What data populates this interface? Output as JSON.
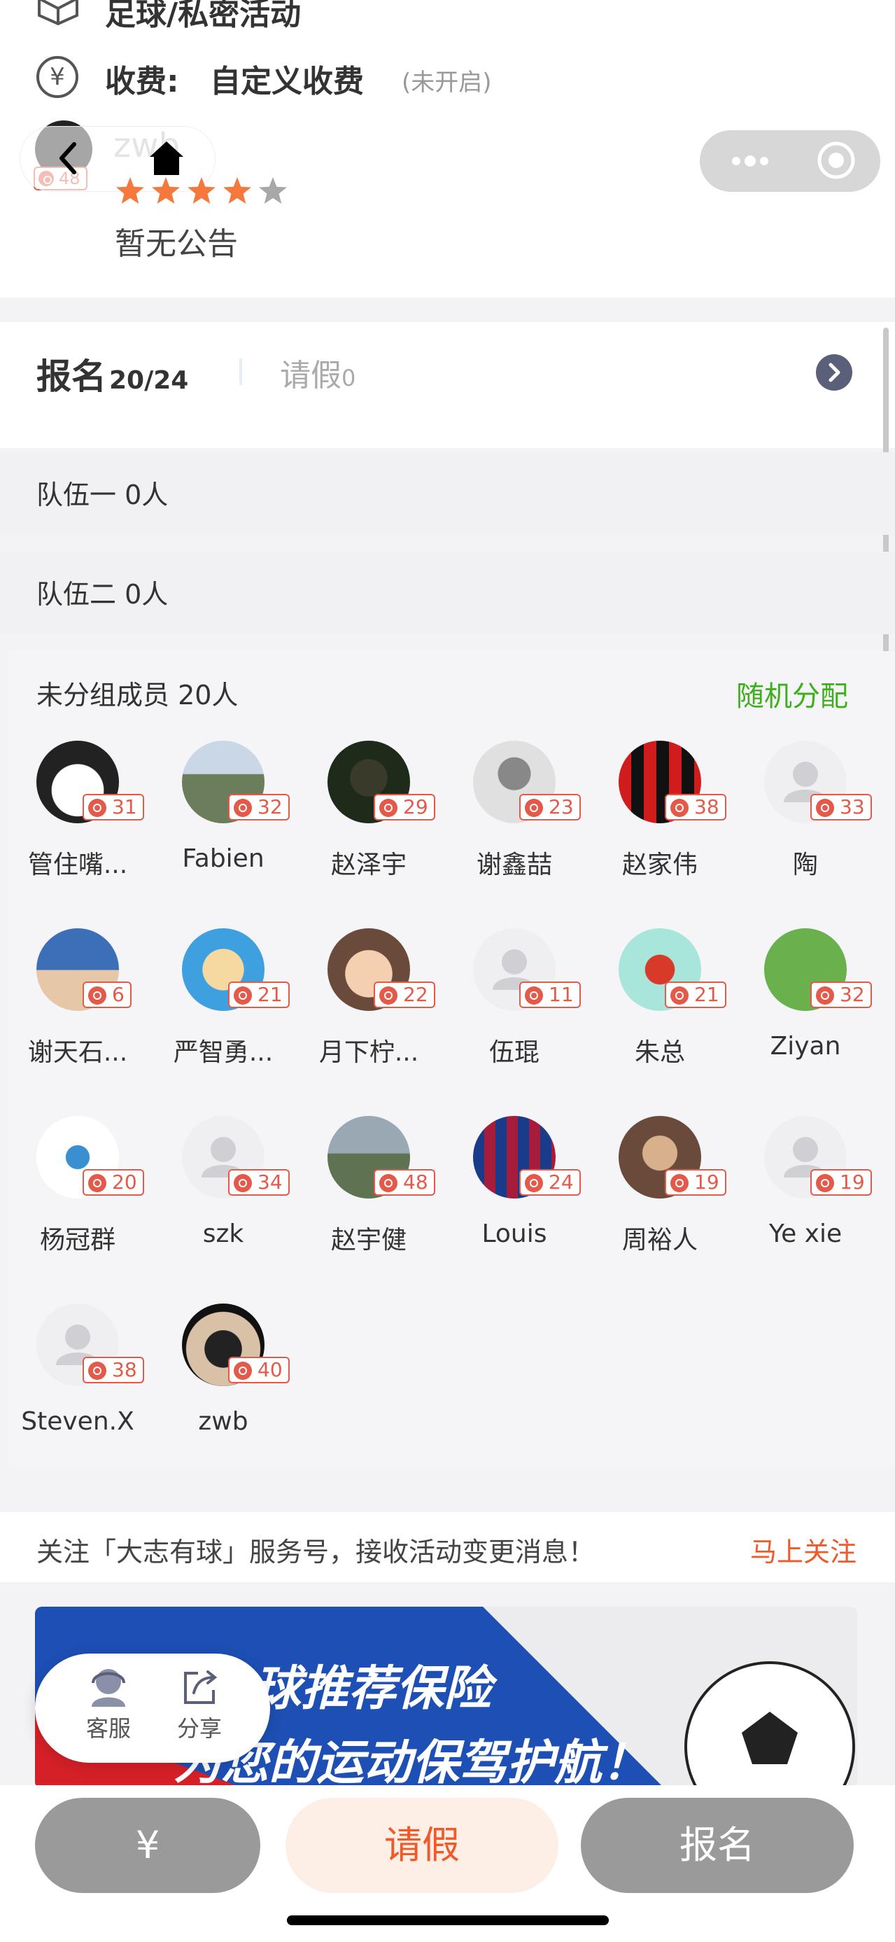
{
  "header": {
    "activity_type": "足球/私密活动",
    "fee_label": "收费:",
    "fee_value": "自定义收费",
    "fee_status": "(未开启)",
    "organizer_name": "zwb",
    "organizer_level": "48",
    "rating_stars": 4,
    "announcement": "暂无公告"
  },
  "signup": {
    "tab_signup": "报名",
    "signup_count": "20/24",
    "tab_leave": "请假",
    "leave_count": "0"
  },
  "teams": [
    {
      "label": "队伍一 0人"
    },
    {
      "label": "队伍二 0人"
    }
  ],
  "unassigned": {
    "title": "未分组成员 20人",
    "random_assign": "随机分配",
    "members": [
      {
        "name": "管住嘴...",
        "level": "31",
        "avatar": "panda"
      },
      {
        "name": "Fabien",
        "level": "32",
        "avatar": "mountain"
      },
      {
        "name": "赵泽宇",
        "level": "29",
        "avatar": "person"
      },
      {
        "name": "谢鑫喆",
        "level": "23",
        "avatar": "sketch"
      },
      {
        "name": "赵家伟",
        "level": "38",
        "avatar": "acm"
      },
      {
        "name": "陶",
        "level": "33",
        "avatar": "default"
      },
      {
        "name": "谢天石...",
        "level": "6",
        "avatar": "baby"
      },
      {
        "name": "严智勇...",
        "level": "21",
        "avatar": "cartoon"
      },
      {
        "name": "月下柠...",
        "level": "22",
        "avatar": "child"
      },
      {
        "name": "伍琨",
        "level": "11",
        "avatar": "default"
      },
      {
        "name": "朱总",
        "level": "21",
        "avatar": "pixel"
      },
      {
        "name": "Ziyan",
        "level": "32",
        "avatar": "field"
      },
      {
        "name": "杨冠群",
        "level": "20",
        "avatar": "bird"
      },
      {
        "name": "szk",
        "level": "34",
        "avatar": "default"
      },
      {
        "name": "赵宇健",
        "level": "48",
        "avatar": "ruins"
      },
      {
        "name": "Louis",
        "level": "24",
        "avatar": "barca"
      },
      {
        "name": "周裕人",
        "level": "19",
        "avatar": "man"
      },
      {
        "name": "Ye xie",
        "level": "19",
        "avatar": "default"
      },
      {
        "name": "Steven.X",
        "level": "38",
        "avatar": "default"
      },
      {
        "name": "zwb",
        "level": "40",
        "avatar": "mask"
      }
    ]
  },
  "follow": {
    "text": "关注「大志有球」服务号，接收活动变更消息！",
    "action": "马上关注"
  },
  "banner": {
    "line1": "球推荐保险",
    "line2": "为您的运动保驾护航！"
  },
  "float_menu": {
    "service": "客服",
    "share": "分享"
  },
  "bottom": {
    "pay": "¥",
    "leave": "请假",
    "signup": "报名"
  },
  "colors": {
    "accent_orange": "#f0592a",
    "green": "#3fae1f",
    "badge_red": "#e45a4a",
    "star": "#f5793c"
  }
}
